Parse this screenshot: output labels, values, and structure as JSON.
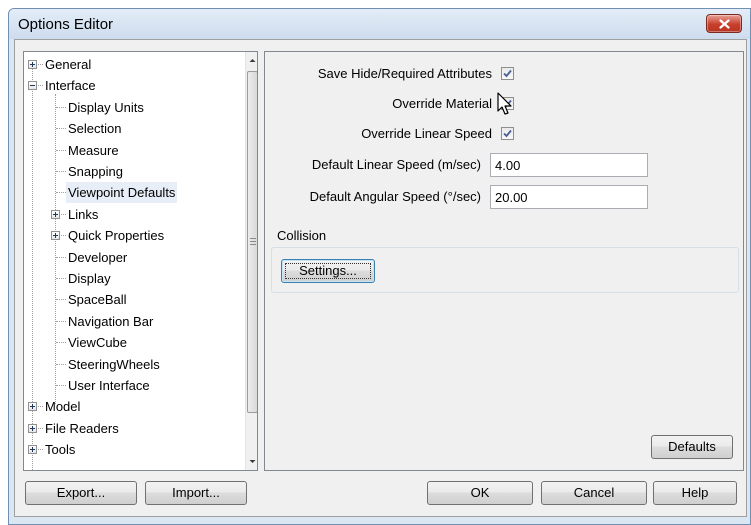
{
  "window": {
    "title": "Options Editor"
  },
  "tree": {
    "items": [
      {
        "label": "General",
        "expander": "plus"
      },
      {
        "label": "Interface",
        "expander": "minus"
      },
      {
        "label": "Display Units"
      },
      {
        "label": "Selection"
      },
      {
        "label": "Measure"
      },
      {
        "label": "Snapping"
      },
      {
        "label": "Viewpoint Defaults",
        "selected": true
      },
      {
        "label": "Links",
        "expander": "plus"
      },
      {
        "label": "Quick Properties",
        "expander": "plus"
      },
      {
        "label": "Developer"
      },
      {
        "label": "Display"
      },
      {
        "label": "SpaceBall"
      },
      {
        "label": "Navigation Bar"
      },
      {
        "label": "ViewCube"
      },
      {
        "label": "SteeringWheels"
      },
      {
        "label": "User Interface"
      },
      {
        "label": "Model",
        "expander": "plus"
      },
      {
        "label": "File Readers",
        "expander": "plus"
      },
      {
        "label": "Tools",
        "expander": "plus"
      }
    ]
  },
  "settings": {
    "save_hide_required": {
      "label": "Save Hide/Required Attributes",
      "checked": true
    },
    "override_material": {
      "label": "Override Material",
      "checked": true
    },
    "override_linear_speed": {
      "label": "Override Linear Speed",
      "checked": true
    },
    "default_linear_speed": {
      "label": "Default Linear Speed (m/sec)",
      "value": "4.00"
    },
    "default_angular_speed": {
      "label": "Default Angular Speed (°/sec)",
      "value": "20.00"
    },
    "collision": {
      "title": "Collision",
      "settings_button": "Settings..."
    }
  },
  "buttons": {
    "defaults": "Defaults",
    "export": "Export...",
    "import": "Import...",
    "ok": "OK",
    "cancel": "Cancel",
    "help": "Help"
  },
  "colors": {
    "title_bar": "#dbe6f3",
    "close_button": "#c7402b",
    "selection": "#e8eef7",
    "focus_border": "#3c7fb1"
  }
}
